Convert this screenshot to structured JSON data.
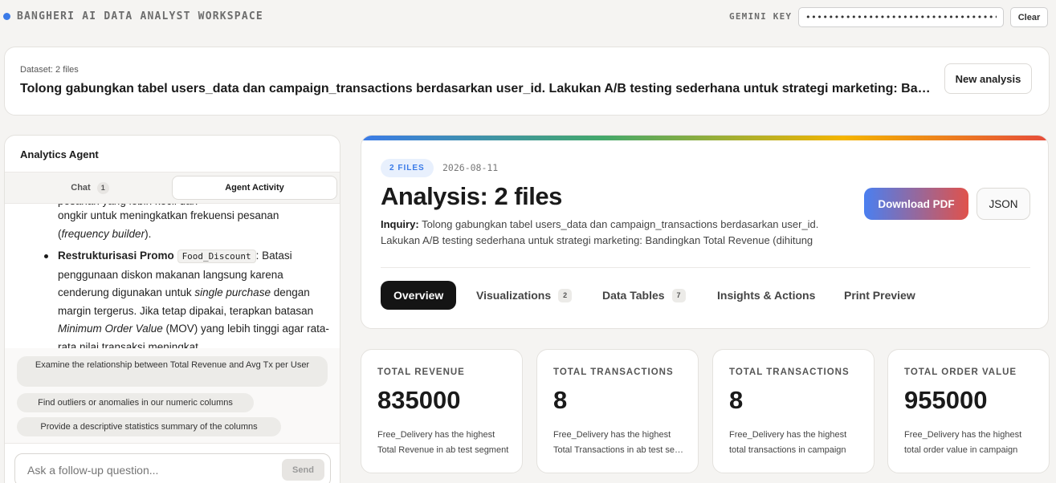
{
  "header": {
    "title": "BANGHERI AI DATA ANALYST WORKSPACE",
    "key_label": "GEMINI KEY",
    "key_value": "••••••••••••••••••••••••••••••••••••••",
    "clear_label": "Clear",
    "accent_color": "#3b7be8"
  },
  "dataset": {
    "label": "Dataset: 2 files",
    "query": "Tolong gabungkan tabel users_data dan campaign_transactions berdasarkan user_id. Lakukan A/B testing sederhana untuk strategi marketing: Bandingkan Total Revenue",
    "new_analysis_label": "New analysis"
  },
  "agent": {
    "title": "Analytics Agent",
    "tabs": [
      {
        "label": "Chat",
        "badge": "1"
      },
      {
        "label": "Agent Activity"
      }
    ],
    "content": {
      "fragment_top": "pesanan yang lebih kecil dan",
      "line1_a": "ongkir untuk meningkatkan frekuensi pesanan (",
      "line1_em": "frequency builder",
      "line1_b": ").",
      "bullet_strong": "Restrukturisasi Promo",
      "bullet_code": "Food_Discount",
      "bullet_text_a": ": Batasi penggunaan diskon makanan langsung karena cenderung digunakan untuk ",
      "bullet_em1": "single purchase",
      "bullet_text_b": " dengan margin tergerus. Jika tetap dipakai, terapkan batasan ",
      "bullet_em2": "Minimum Order Value",
      "bullet_text_c": " (MOV) yang lebih tinggi agar rata-rata nilai transaksi meningkat."
    },
    "suggestions": [
      "Examine the relationship between Total Revenue and Avg Tx per User",
      "Find outliers or anomalies in our numeric columns",
      "Provide a descriptive statistics summary of the columns"
    ],
    "input_placeholder": "Ask a follow-up question...",
    "send_label": "Send"
  },
  "analysis": {
    "badge": "2 FILES",
    "date": "2026-08-11",
    "title": "Analysis: 2 files",
    "inquiry_label": "Inquiry:",
    "inquiry_line1": "Tolong gabungkan tabel users_data dan campaign_transactions berdasarkan user_id.",
    "inquiry_line2": "Lakukan A/B testing sederhana untuk strategi marketing: Bandingkan Total Revenue (dihitung",
    "download_label": "Download PDF",
    "json_label": "JSON",
    "tabs": [
      {
        "label": "Overview",
        "active": true
      },
      {
        "label": "Visualizations",
        "badge": "2"
      },
      {
        "label": "Data Tables",
        "badge": "7"
      },
      {
        "label": "Insights & Actions"
      },
      {
        "label": "Print Preview"
      }
    ]
  },
  "stats": [
    {
      "label": "TOTAL REVENUE",
      "value": "835000",
      "desc1": "Free_Delivery has the highest",
      "desc2": "Total Revenue in ab test segment"
    },
    {
      "label": "TOTAL TRANSACTIONS",
      "value": "8",
      "desc1": "Free_Delivery has the highest",
      "desc2": "Total Transactions in ab test segment"
    },
    {
      "label": "TOTAL TRANSACTIONS",
      "value": "8",
      "desc1": "Free_Delivery has the highest",
      "desc2": "total transactions in campaign"
    },
    {
      "label": "TOTAL ORDER VALUE",
      "value": "955000",
      "desc1": "Free_Delivery has the highest",
      "desc2": "total order value in campaign"
    }
  ]
}
